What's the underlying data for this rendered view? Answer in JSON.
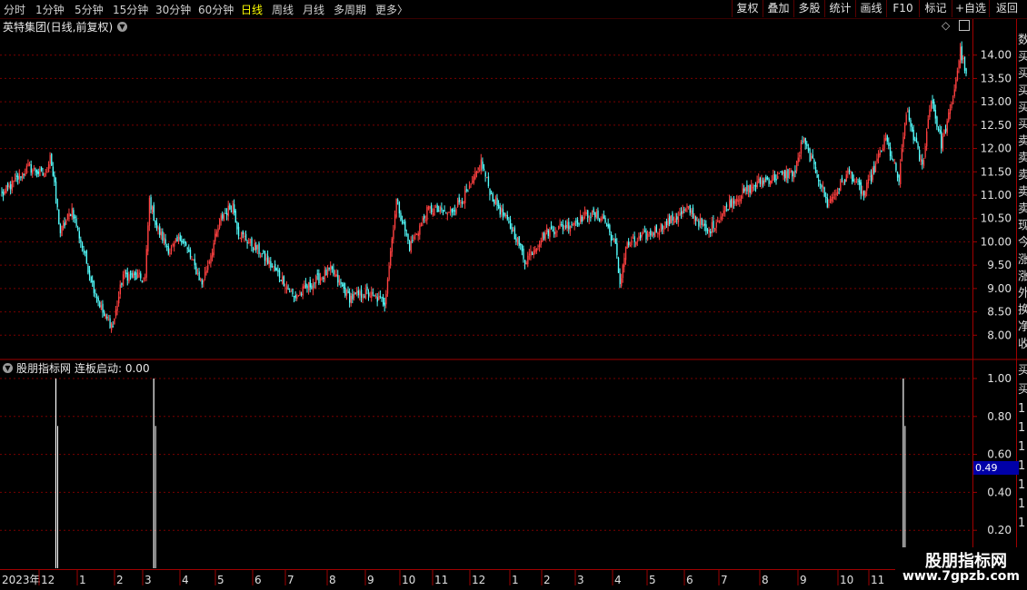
{
  "toolbar": {
    "periods": [
      "分时",
      "1分钟",
      "5分钟",
      "15分钟",
      "30分钟",
      "60分钟",
      "日线",
      "周线",
      "月线",
      "多周期",
      "更多"
    ],
    "active_period": "日线",
    "more_arrow": "〉",
    "right_buttons": [
      "复权",
      "叠加",
      "多股",
      "统计",
      "画线",
      "F10",
      "标记",
      "+自选",
      "返回"
    ]
  },
  "main_chart": {
    "title": "英特集团(日线,前复权)",
    "menu_icon": "chevron-down-icon",
    "y_ticks": [
      "14.00",
      "13.50",
      "13.00",
      "12.50",
      "12.00",
      "11.50",
      "11.00",
      "10.50",
      "10.00",
      "9.50",
      "9.00",
      "8.50",
      "8.00"
    ],
    "right_panel_chars": [
      "数",
      "买",
      "买",
      "买",
      "买",
      "买",
      "卖",
      "卖",
      "卖",
      "卖",
      "卖",
      "现",
      "今",
      "涨",
      "涨",
      "外",
      "换",
      "净",
      "收"
    ]
  },
  "indicator": {
    "name": "股朋指标网",
    "label": "连板启动: 0.00",
    "y_ticks": [
      "1.00",
      "0.80",
      "0.60",
      "0.40",
      "0.20"
    ],
    "highlight_value": "0.49",
    "right_panel_chars": [
      "买",
      "买",
      "1",
      "1",
      "1",
      "1",
      "1",
      "1",
      "1"
    ]
  },
  "x_axis": {
    "year_label": "2023年",
    "months": [
      "12",
      "1",
      "2",
      "3",
      "4",
      "5",
      "6",
      "7",
      "8",
      "9",
      "10",
      "11",
      "12",
      "1",
      "2",
      "3",
      "4",
      "5",
      "6",
      "7",
      "8",
      "9",
      "10",
      "11"
    ]
  },
  "watermark": {
    "name": "股朋指标网",
    "url": "www.7gpzb.com"
  },
  "colors": {
    "up": "#ff4040",
    "down": "#54ffff",
    "grid": "#7a0000",
    "signal": "#ffffff",
    "axis_text": "#e0e0e0",
    "active_period": "#ffff00"
  },
  "chart_data": {
    "type": "candlestick",
    "instrument": "英特集团",
    "ylim": [
      7.5,
      14.5
    ],
    "signal_ylim": [
      0,
      1
    ],
    "keypoints": [
      [
        0,
        11.0
      ],
      [
        18,
        11.6
      ],
      [
        30,
        11.4
      ],
      [
        33,
        11.9
      ],
      [
        40,
        10.2
      ],
      [
        48,
        10.7
      ],
      [
        62,
        9.1
      ],
      [
        70,
        8.4
      ],
      [
        76,
        8.2
      ],
      [
        83,
        9.3
      ],
      [
        98,
        9.2
      ],
      [
        101,
        10.9
      ],
      [
        106,
        10.3
      ],
      [
        115,
        9.8
      ],
      [
        123,
        10.1
      ],
      [
        137,
        9.1
      ],
      [
        150,
        10.5
      ],
      [
        158,
        10.8
      ],
      [
        162,
        10.2
      ],
      [
        176,
        9.8
      ],
      [
        192,
        9.2
      ],
      [
        200,
        8.8
      ],
      [
        212,
        9.1
      ],
      [
        225,
        9.4
      ],
      [
        238,
        8.8
      ],
      [
        250,
        8.9
      ],
      [
        262,
        8.7
      ],
      [
        270,
        10.9
      ],
      [
        279,
        9.9
      ],
      [
        292,
        10.7
      ],
      [
        306,
        10.6
      ],
      [
        320,
        11.1
      ],
      [
        328,
        11.7
      ],
      [
        335,
        11.0
      ],
      [
        352,
        10.1
      ],
      [
        358,
        9.6
      ],
      [
        372,
        10.2
      ],
      [
        390,
        10.4
      ],
      [
        402,
        10.6
      ],
      [
        412,
        10.5
      ],
      [
        420,
        9.9
      ],
      [
        423,
        9.1
      ],
      [
        427,
        9.9
      ],
      [
        445,
        10.2
      ],
      [
        470,
        10.7
      ],
      [
        483,
        10.2
      ],
      [
        500,
        10.9
      ],
      [
        520,
        11.3
      ],
      [
        543,
        11.5
      ],
      [
        548,
        12.2
      ],
      [
        560,
        11.3
      ],
      [
        565,
        10.8
      ],
      [
        580,
        11.5
      ],
      [
        590,
        11.0
      ],
      [
        605,
        12.2
      ],
      [
        614,
        11.3
      ],
      [
        619,
        12.8
      ],
      [
        630,
        11.6
      ],
      [
        636,
        13.1
      ],
      [
        643,
        12.1
      ],
      [
        650,
        12.9
      ],
      [
        656,
        14.1
      ],
      [
        660,
        13.6
      ]
    ],
    "signals": [
      {
        "index": 37,
        "value": 1.0
      },
      {
        "index": 104,
        "value": 1.0
      },
      {
        "index": 617,
        "value": 1.0
      }
    ]
  }
}
